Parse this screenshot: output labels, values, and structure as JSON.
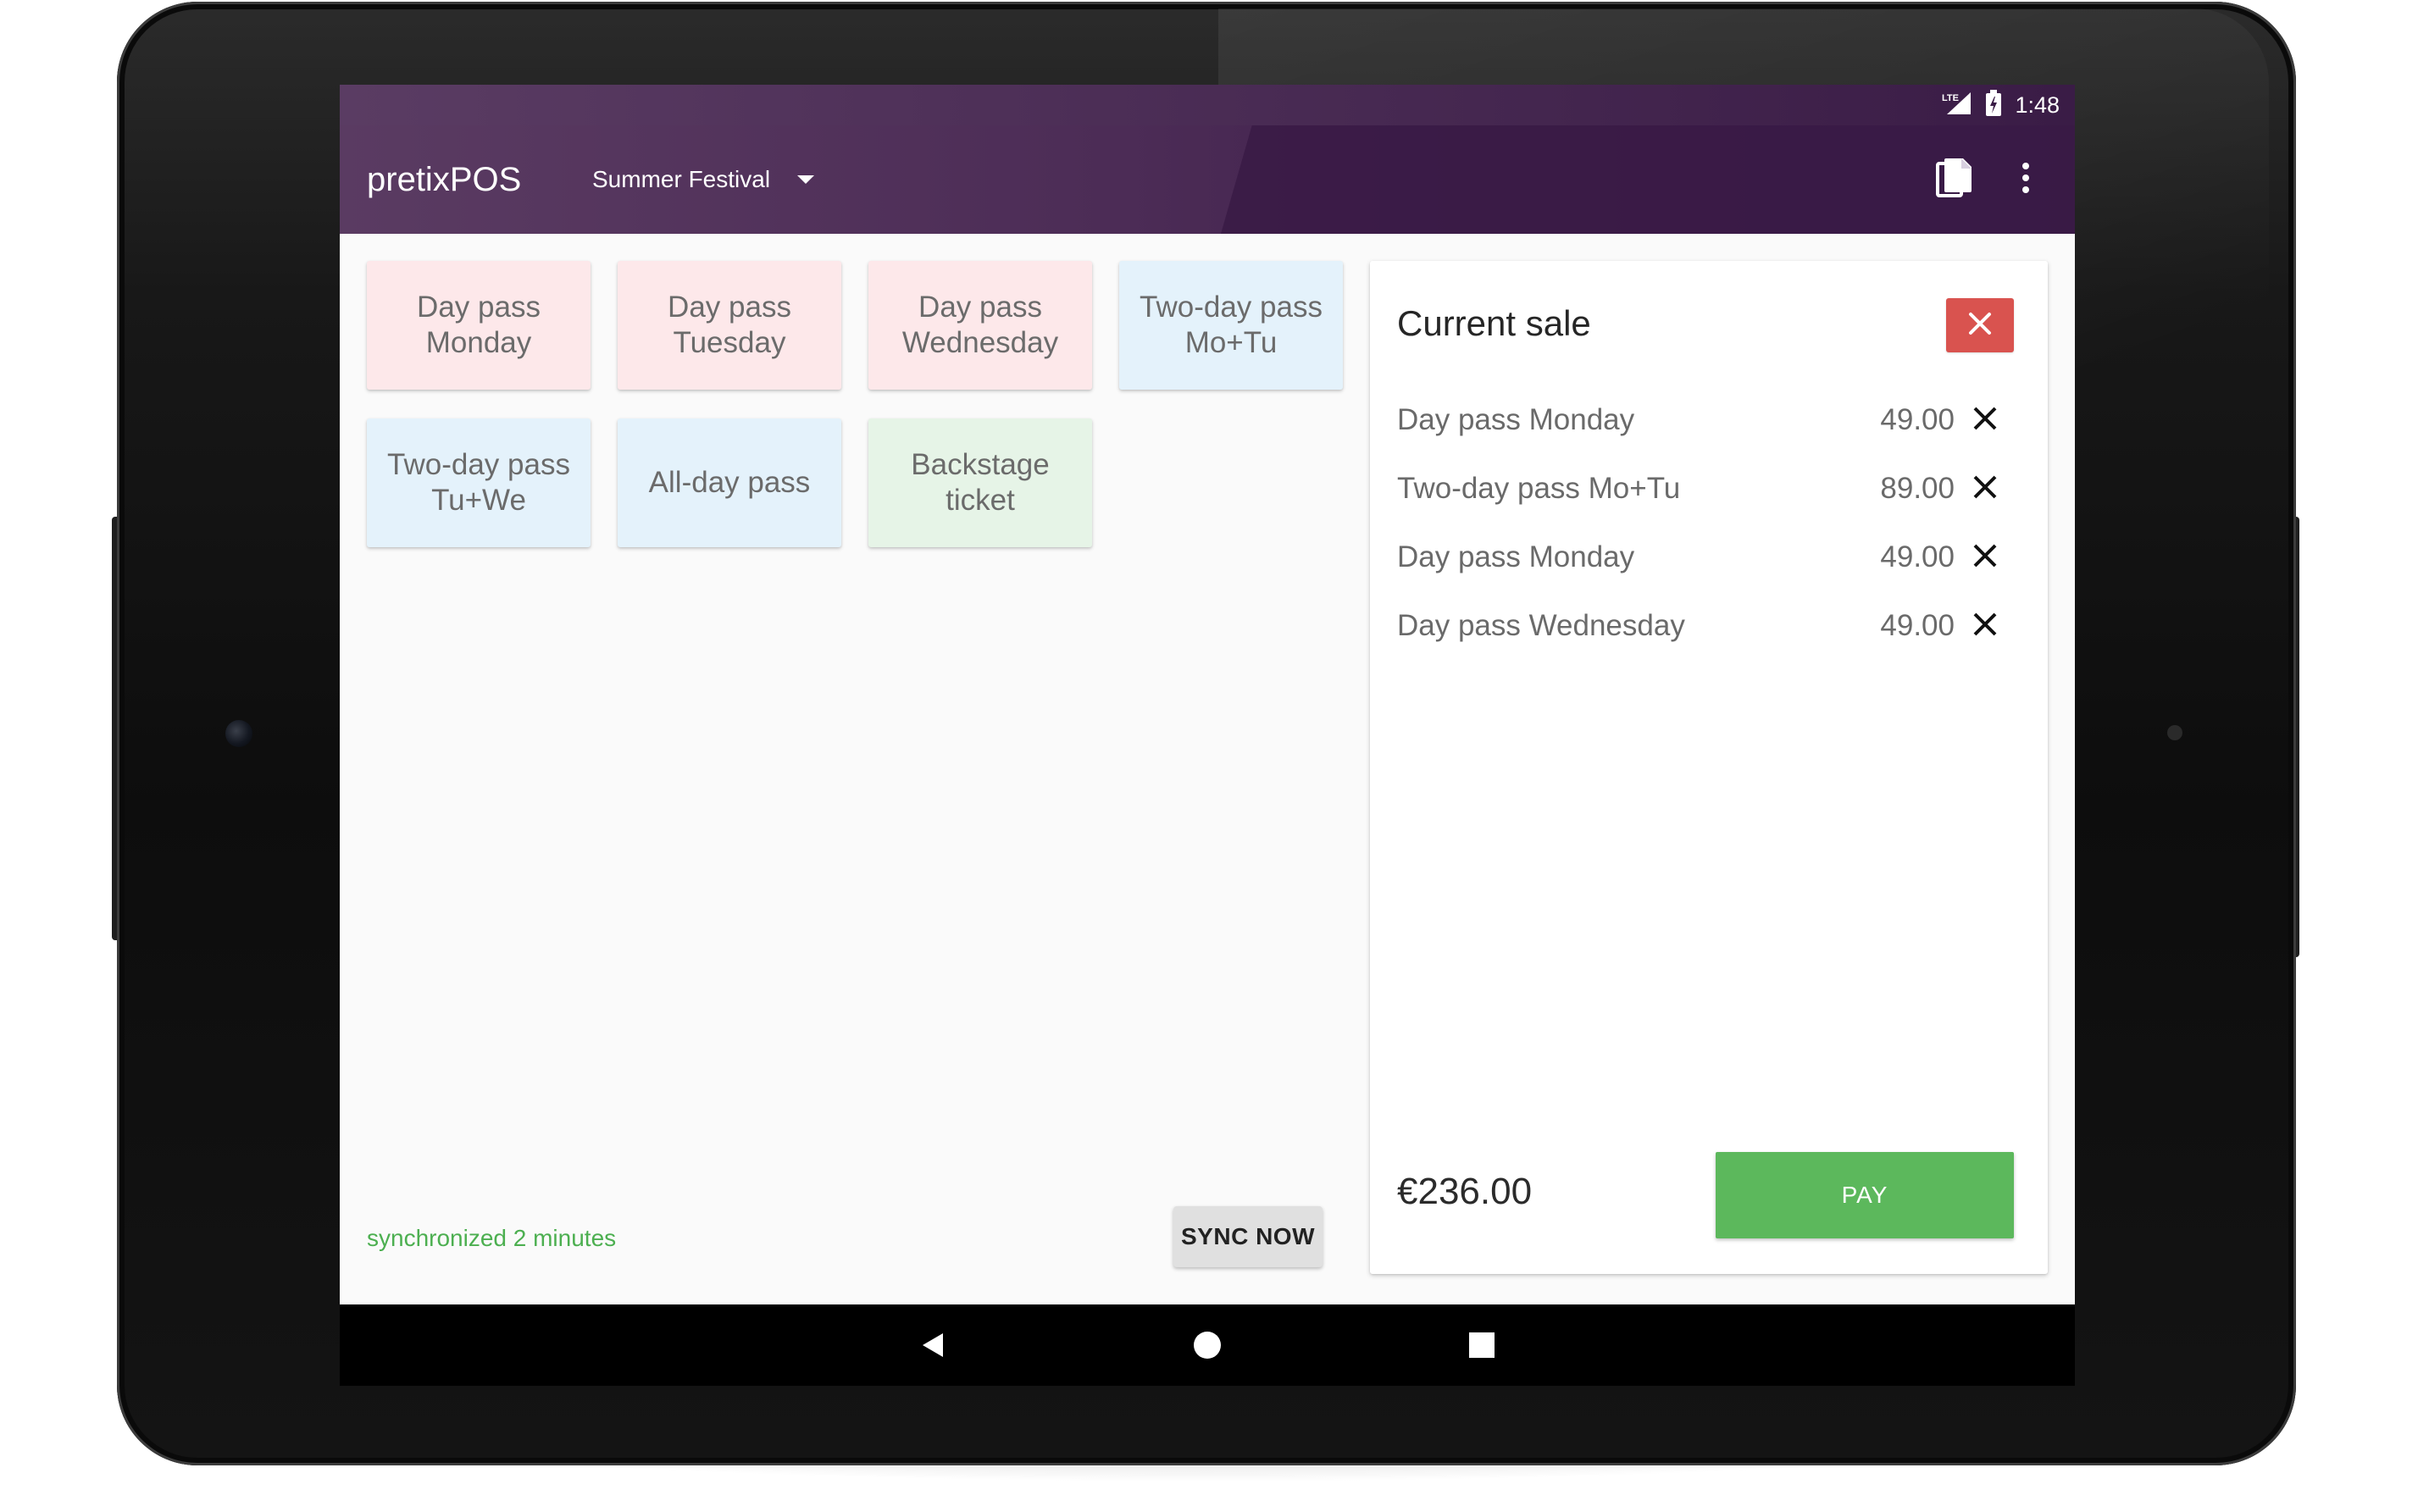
{
  "status_bar": {
    "network": "LTE",
    "time": "1:48"
  },
  "app_bar": {
    "title": "pretixPOS",
    "event": "Summer Festival",
    "icons": [
      "event-dropdown-icon",
      "document-icon",
      "overflow-menu-icon"
    ]
  },
  "products": [
    {
      "label": "Day pass Monday",
      "color": "#fde8ea"
    },
    {
      "label": "Day pass Tuesday",
      "color": "#fde8ea"
    },
    {
      "label": "Day pass Wednesday",
      "color": "#fde8ea"
    },
    {
      "label": "Two-day pass Mo+Tu",
      "color": "#e4f2fb"
    },
    {
      "label": "Two-day pass Tu+We",
      "color": "#e4f2fb"
    },
    {
      "label": "All-day pass",
      "color": "#e4f2fb"
    },
    {
      "label": "Backstage ticket",
      "color": "#e6f4e7"
    }
  ],
  "sync": {
    "status": "synchronized 2 minutes",
    "button": "SYNC NOW",
    "status_color": "#4caf50"
  },
  "sale": {
    "title": "Current sale",
    "items": [
      {
        "name": "Day pass Monday",
        "price": "49.00"
      },
      {
        "name": "Two-day pass Mo+Tu",
        "price": "89.00"
      },
      {
        "name": "Day pass Monday",
        "price": "49.00"
      },
      {
        "name": "Day pass Wednesday",
        "price": "49.00"
      }
    ],
    "total": "€236.00",
    "pay_label": "PAY",
    "clear_color": "#d9534f",
    "pay_color": "#5cb85c"
  },
  "nav": {
    "icons": [
      "back-icon",
      "home-icon",
      "recents-icon"
    ]
  },
  "colors": {
    "app_bar": "#4c2c56",
    "accent": "#5cb85c"
  }
}
